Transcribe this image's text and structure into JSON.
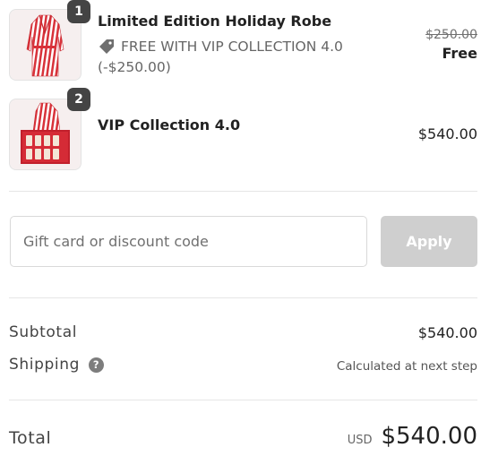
{
  "line_items": [
    {
      "quantity": "1",
      "name": "Limited Edition Holiday Robe",
      "discount_label": "FREE WITH VIP COLLECTION 4.0",
      "discount_amount": "(-$250.00)",
      "original_price": "$250.00",
      "price": "Free",
      "image_icon": "striped-robe-image"
    },
    {
      "quantity": "2",
      "name": "VIP Collection 4.0",
      "price": "$540.00",
      "image_icon": "robe-and-gift-box-image"
    }
  ],
  "discount": {
    "placeholder": "Gift card or discount code",
    "value": "",
    "apply_label": "Apply"
  },
  "summary": {
    "subtotal_label": "Subtotal",
    "subtotal_value": "$540.00",
    "shipping_label": "Shipping",
    "shipping_help_icon": "?",
    "shipping_value": "Calculated at next step",
    "total_label": "Total",
    "currency": "USD",
    "total_value": "$540.00"
  },
  "colors": {
    "apply_button_bg": "#cfcfcf",
    "quantity_badge_bg": "#444444",
    "robe_stripe": "#d8323a"
  }
}
